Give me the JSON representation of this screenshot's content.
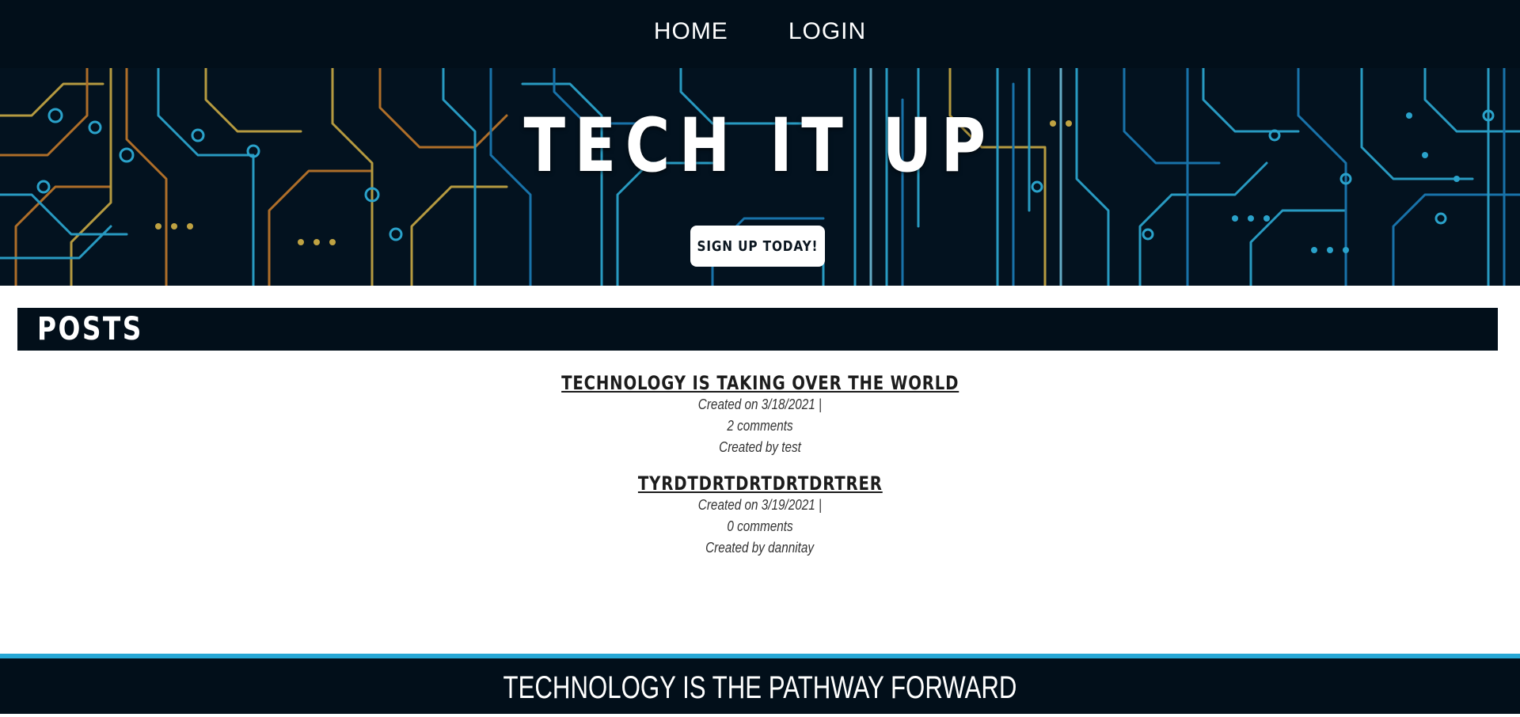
{
  "nav": {
    "home_label": "HOME",
    "login_label": "LOGIN"
  },
  "hero": {
    "title": "TECH IT UP",
    "signup_label": "SIGN UP TODAY!"
  },
  "posts": {
    "heading": "POSTS",
    "items": [
      {
        "title": "TECHNOLOGY IS TAKING OVER THE WORLD",
        "created": "Created on 3/18/2021 |",
        "comments": "2 comments",
        "author": "Created by test"
      },
      {
        "title": "TYRDTDRTDRTDRTDRTRER",
        "created": "Created on 3/19/2021 |",
        "comments": "0 comments",
        "author": "Created by dannitay"
      }
    ]
  },
  "footer": {
    "text": "TECHNOLOGY IS THE PATHWAY FORWARD"
  },
  "colors": {
    "nav_bg": "#020f1a",
    "footer_accent": "#27a8d6",
    "circuit_blue": "#33c2f0",
    "circuit_orange": "#e08a2c",
    "circuit_yellow": "#e8c24a"
  }
}
